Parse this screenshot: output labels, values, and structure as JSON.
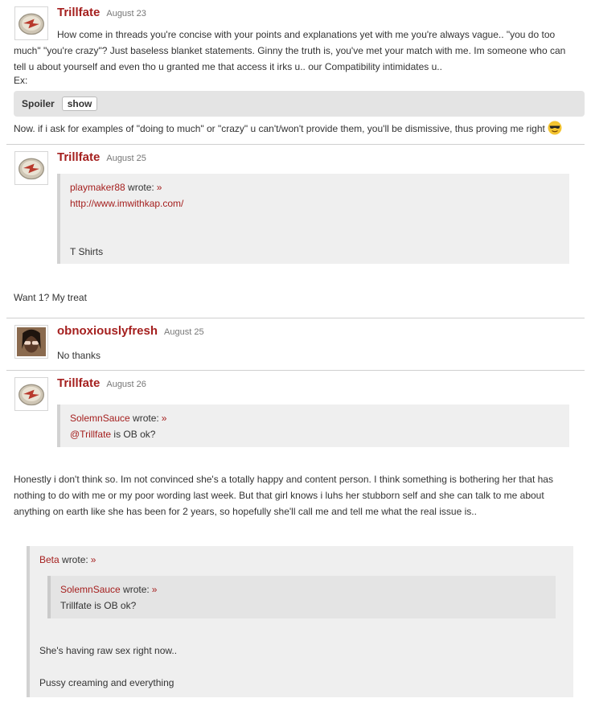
{
  "posts": [
    {
      "author": "Trillfate",
      "date": "August 23",
      "lines": [
        "How come in threads you're concise with your points and explanations yet with me you're always vague.. \"you do too",
        "much\" \"you're crazy\"? Just baseless blanket statements. Ginny the truth is, you've met your match with me. Im someone who can",
        "tell u about yourself and even tho u granted me that access it irks u.. our Compatibility intimidates u..",
        "Ex:"
      ],
      "spoiler": {
        "label": "Spoiler",
        "button": "show"
      },
      "after": "Now. if i ask for examples of \"doing to much\" or \"crazy\" u can't/won't provide them, you'll be dismissive, thus proving me right",
      "emoji": "sunglasses-emoji"
    },
    {
      "author": "Trillfate",
      "date": "August 25",
      "quote": {
        "who": "playmaker88",
        "wrote": " wrote:",
        "arrow": "»",
        "link": "http://www.imwithkap.com/",
        "text": "T Shirts"
      },
      "reply": "Want 1? My treat"
    },
    {
      "author": "obnoxiouslyfresh",
      "date": "August 25",
      "text": "No thanks"
    },
    {
      "author": "Trillfate",
      "date": "August 26",
      "quote": {
        "who": "SolemnSauce",
        "wrote": " wrote:",
        "arrow": "»",
        "mention": "@Trillfate",
        "rest": " is OB ok?"
      },
      "reply_lines": [
        "Honestly i don't think so. Im not convinced she's a totally happy and content person. I think something is bothering her that has",
        "nothing to do with me or my poor wording last week. But that girl knows i luhs her stubborn self and she can talk to me about",
        "anything on earth like she has been for 2 years, so hopefully she'll call me and tell me what the real issue is.."
      ],
      "outer_quote": {
        "who": "Beta",
        "wrote": " wrote:",
        "arrow": "»",
        "inner": {
          "who": "SolemnSauce",
          "wrote": " wrote:",
          "arrow": "»",
          "text": "Trillfate is OB ok?"
        },
        "line1": "She's having raw sex right now..",
        "line2": "Pussy creaming and everything"
      }
    }
  ],
  "colors": {
    "accent": "#a5201f",
    "quote_bg": "#efefef",
    "spoiler_bg": "#e4e4e4"
  }
}
